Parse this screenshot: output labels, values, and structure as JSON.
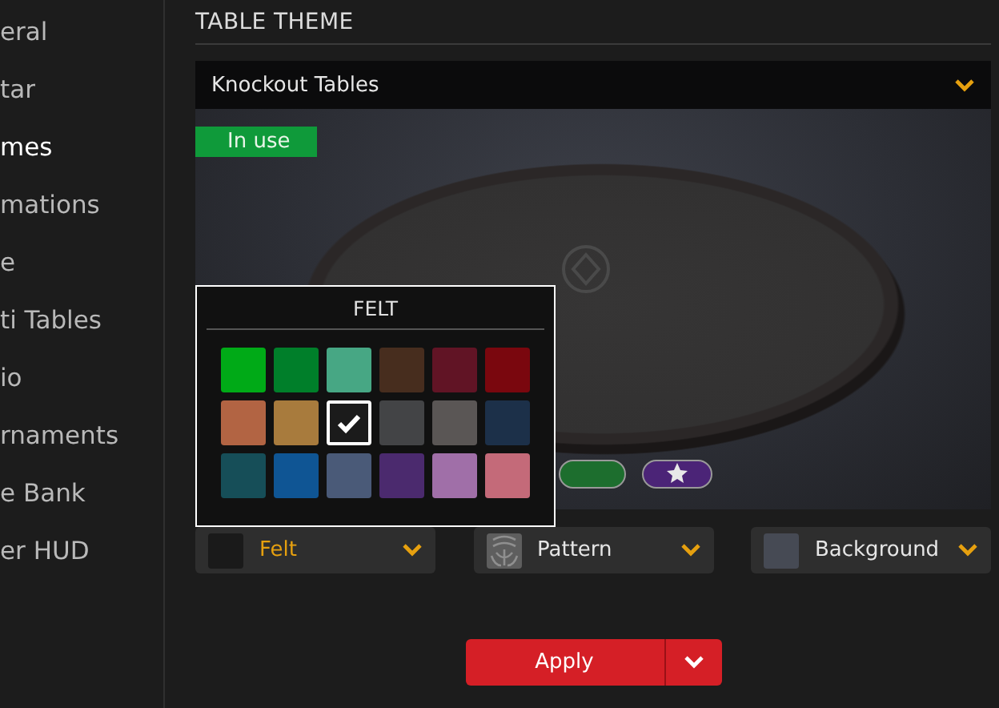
{
  "sidebar": {
    "items": [
      {
        "label": "eral",
        "selected": false
      },
      {
        "label": "tar",
        "selected": false
      },
      {
        "label": "mes",
        "selected": true
      },
      {
        "label": "mations",
        "selected": false
      },
      {
        "label": "e",
        "selected": false
      },
      {
        "label": "ti Tables",
        "selected": false
      },
      {
        "label": "io",
        "selected": false
      },
      {
        "label": "rnaments",
        "selected": false
      },
      {
        "label": "e Bank",
        "selected": false
      },
      {
        "label": "er HUD",
        "selected": false
      }
    ]
  },
  "section_title": "TABLE THEME",
  "theme_dropdown": {
    "value": "Knockout Tables"
  },
  "preview": {
    "badge": "In use"
  },
  "felt_popup": {
    "title": "FELT",
    "swatches": [
      {
        "color": "#00aa17",
        "selected": false
      },
      {
        "color": "#007f2a",
        "selected": false
      },
      {
        "color": "#47a784",
        "selected": false
      },
      {
        "color": "#472d1e",
        "selected": false
      },
      {
        "color": "#611425",
        "selected": false
      },
      {
        "color": "#7a070e",
        "selected": false
      },
      {
        "color": "#b26443",
        "selected": false
      },
      {
        "color": "#a87b3d",
        "selected": false
      },
      {
        "color": "#1b1b1b",
        "selected": true
      },
      {
        "color": "#434446",
        "selected": false
      },
      {
        "color": "#5a5655",
        "selected": false
      },
      {
        "color": "#1c3049",
        "selected": false
      },
      {
        "color": "#164e58",
        "selected": false
      },
      {
        "color": "#0f5594",
        "selected": false
      },
      {
        "color": "#4a5a78",
        "selected": false
      },
      {
        "color": "#4b2a6e",
        "selected": false
      },
      {
        "color": "#a06fa8",
        "selected": false
      },
      {
        "color": "#c46a79",
        "selected": false
      }
    ]
  },
  "selectors": [
    {
      "label": "Felt",
      "kind": "color",
      "color": "#1a1a1a",
      "open": true
    },
    {
      "label": "Pattern",
      "kind": "pattern",
      "open": false
    },
    {
      "label": "Background",
      "kind": "color",
      "color": "#464a54",
      "open": false
    }
  ],
  "apply_button": {
    "label": "Apply"
  }
}
